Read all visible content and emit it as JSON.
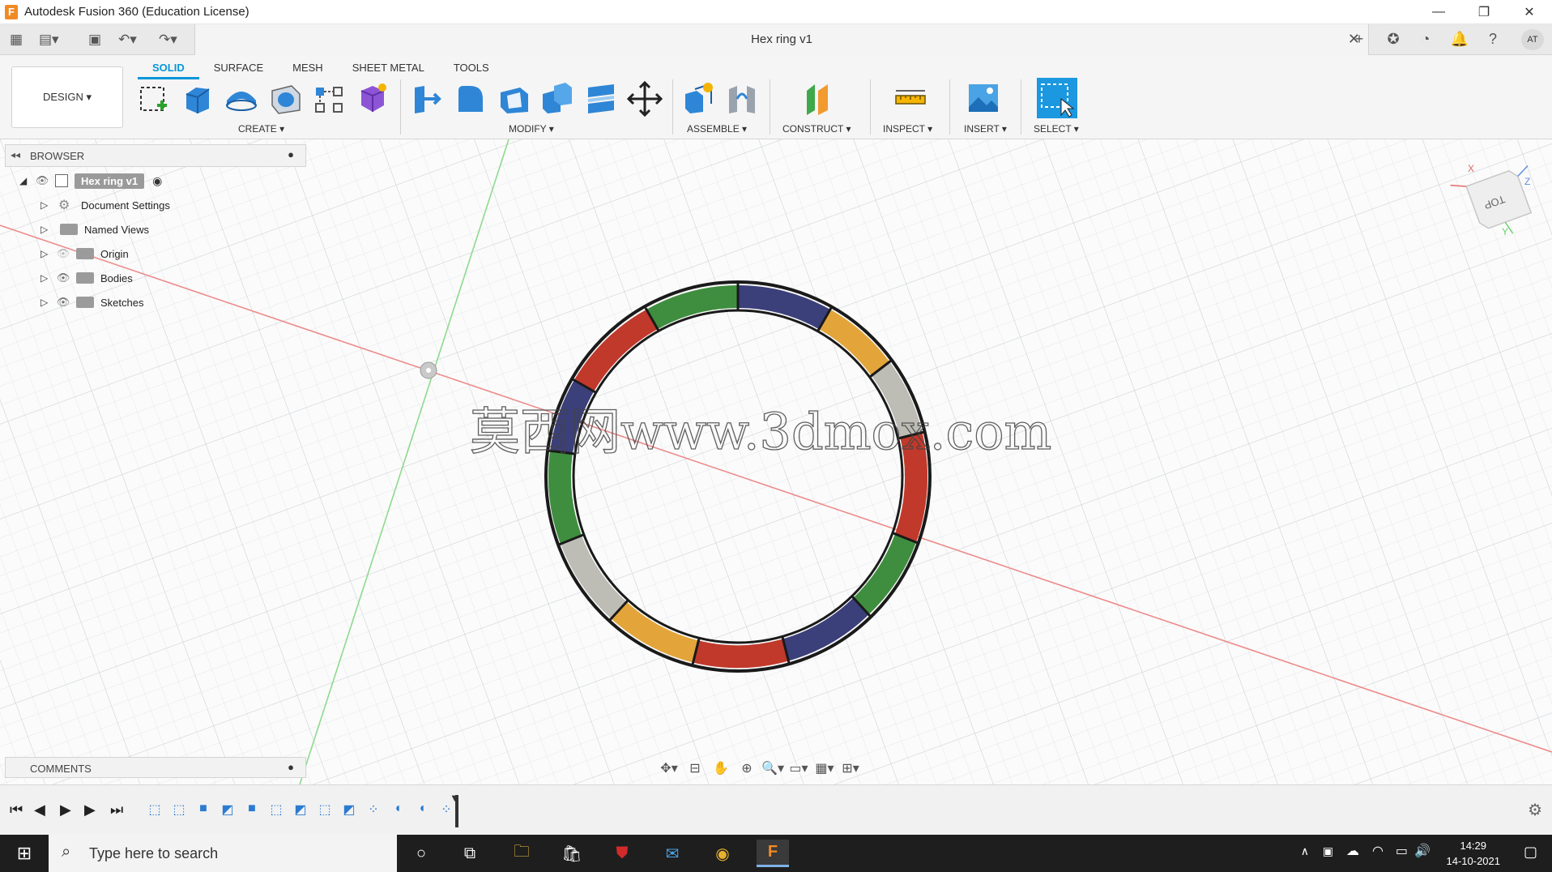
{
  "window": {
    "app_icon": "F",
    "title": "Autodesk Fusion 360 (Education License)",
    "minimize_icon": "—",
    "restore_icon": "❐",
    "close_icon": "✕"
  },
  "document": {
    "title": "Hex ring v1",
    "close_icon": "✕"
  },
  "ribbon": {
    "workspace": "DESIGN ▾",
    "tabs": [
      "SOLID",
      "SURFACE",
      "MESH",
      "SHEET METAL",
      "TOOLS"
    ],
    "active_tab": "SOLID",
    "groups": {
      "create": "CREATE ▾",
      "modify": "MODIFY ▾",
      "assemble": "ASSEMBLE ▾",
      "construct": "CONSTRUCT ▾",
      "inspect": "INSPECT ▾",
      "insert": "INSERT ▾",
      "select": "SELECT ▾"
    }
  },
  "browser": {
    "title": "BROWSER",
    "root": "Hex ring v1",
    "items": [
      {
        "label": "Document Settings",
        "icon": "gear-icon"
      },
      {
        "label": "Named Views",
        "icon": "folder-icon"
      },
      {
        "label": "Origin",
        "icon": "folder-icon"
      },
      {
        "label": "Bodies",
        "icon": "folder-icon"
      },
      {
        "label": "Sketches",
        "icon": "folder-icon"
      }
    ]
  },
  "comments": {
    "title": "COMMENTS"
  },
  "viewcube": {
    "face": "TOP",
    "axis_x": "X",
    "axis_y": "Y",
    "axis_z": "Z"
  },
  "watermark": "莫西网www.3dmox.com",
  "taskbar": {
    "search_placeholder": "Type here to search",
    "time": "14:29",
    "date": "14-10-2021"
  },
  "colors": {
    "accent": "#0696d7",
    "ring_green": "#3f8e3f",
    "ring_navy": "#3b3f7a",
    "ring_orange": "#e3a53a",
    "ring_grey": "#bdbcb5",
    "ring_red": "#c0392b"
  }
}
